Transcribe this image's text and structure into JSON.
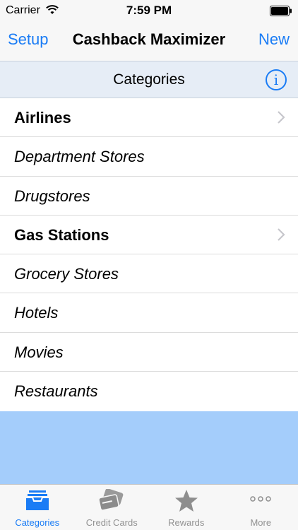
{
  "status_bar": {
    "carrier": "Carrier",
    "time": "7:59 PM"
  },
  "nav": {
    "left_button": "Setup",
    "title": "Cashback Maximizer",
    "right_button": "New"
  },
  "section": {
    "title": "Categories",
    "info_glyph": "i"
  },
  "categories": [
    {
      "label": "Airlines",
      "style": "bold",
      "has_chevron": true
    },
    {
      "label": "Department Stores",
      "style": "italic",
      "has_chevron": false
    },
    {
      "label": "Drugstores",
      "style": "italic",
      "has_chevron": false
    },
    {
      "label": "Gas Stations",
      "style": "bold",
      "has_chevron": true
    },
    {
      "label": "Grocery Stores",
      "style": "italic",
      "has_chevron": false
    },
    {
      "label": "Hotels",
      "style": "italic",
      "has_chevron": false
    },
    {
      "label": "Movies",
      "style": "italic",
      "has_chevron": false
    },
    {
      "label": "Restaurants",
      "style": "italic",
      "has_chevron": false
    }
  ],
  "tabs": [
    {
      "label": "Categories",
      "icon": "inbox-tray-icon",
      "active": true
    },
    {
      "label": "Credit Cards",
      "icon": "credit-cards-icon",
      "active": false
    },
    {
      "label": "Rewards",
      "icon": "star-icon",
      "active": false
    },
    {
      "label": "More",
      "icon": "more-dots-icon",
      "active": false
    }
  ],
  "colors": {
    "accent": "#1a7cf5",
    "bar_bg": "#f7f7f7",
    "section_bg": "#e6edf6",
    "blue_fill": "#a4cdfb",
    "tab_inactive": "#929292"
  }
}
